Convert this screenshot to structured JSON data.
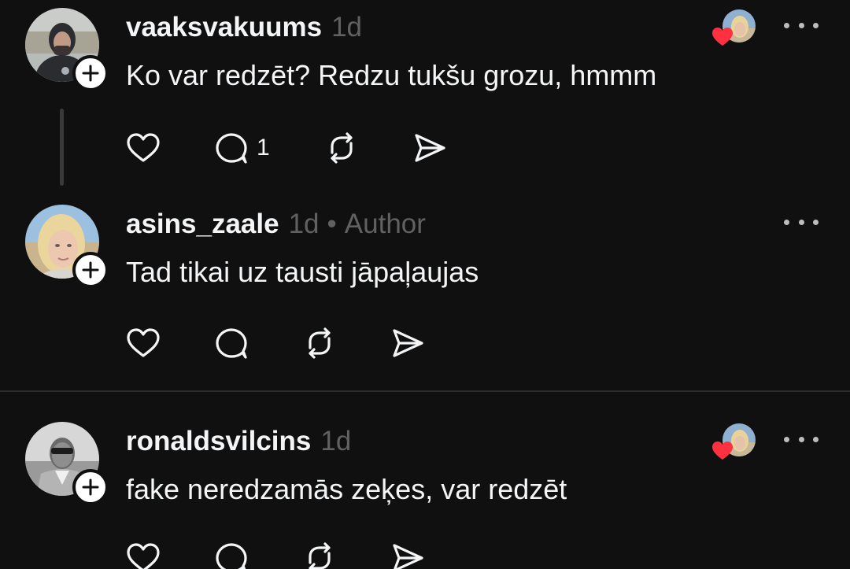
{
  "posts": [
    {
      "username": "vaaksvakuums",
      "time": "1d",
      "text": "Ko var redzēt? Redzu tukšu grozu, hmmm",
      "reply_count": "1",
      "liked_by_author": true
    },
    {
      "username": "asins_zaale",
      "time": "1d",
      "separator": "•",
      "author_badge": "Author",
      "text": "Tad tikai uz tausti jāpaļaujas",
      "reply_count": "",
      "liked_by_author": false
    },
    {
      "username": "ronaldsvilcins",
      "time": "1d",
      "text": "fake neredzamās zeķes, var redzēt",
      "reply_count": "",
      "liked_by_author": true
    }
  ],
  "colors": {
    "background": "#101010",
    "primary_text": "#f3f5f7",
    "secondary_text": "#616161",
    "heart": "#ff3040"
  },
  "icons": [
    "heart-icon",
    "comment-icon",
    "repost-icon",
    "share-icon",
    "more-icon",
    "plus-icon"
  ]
}
